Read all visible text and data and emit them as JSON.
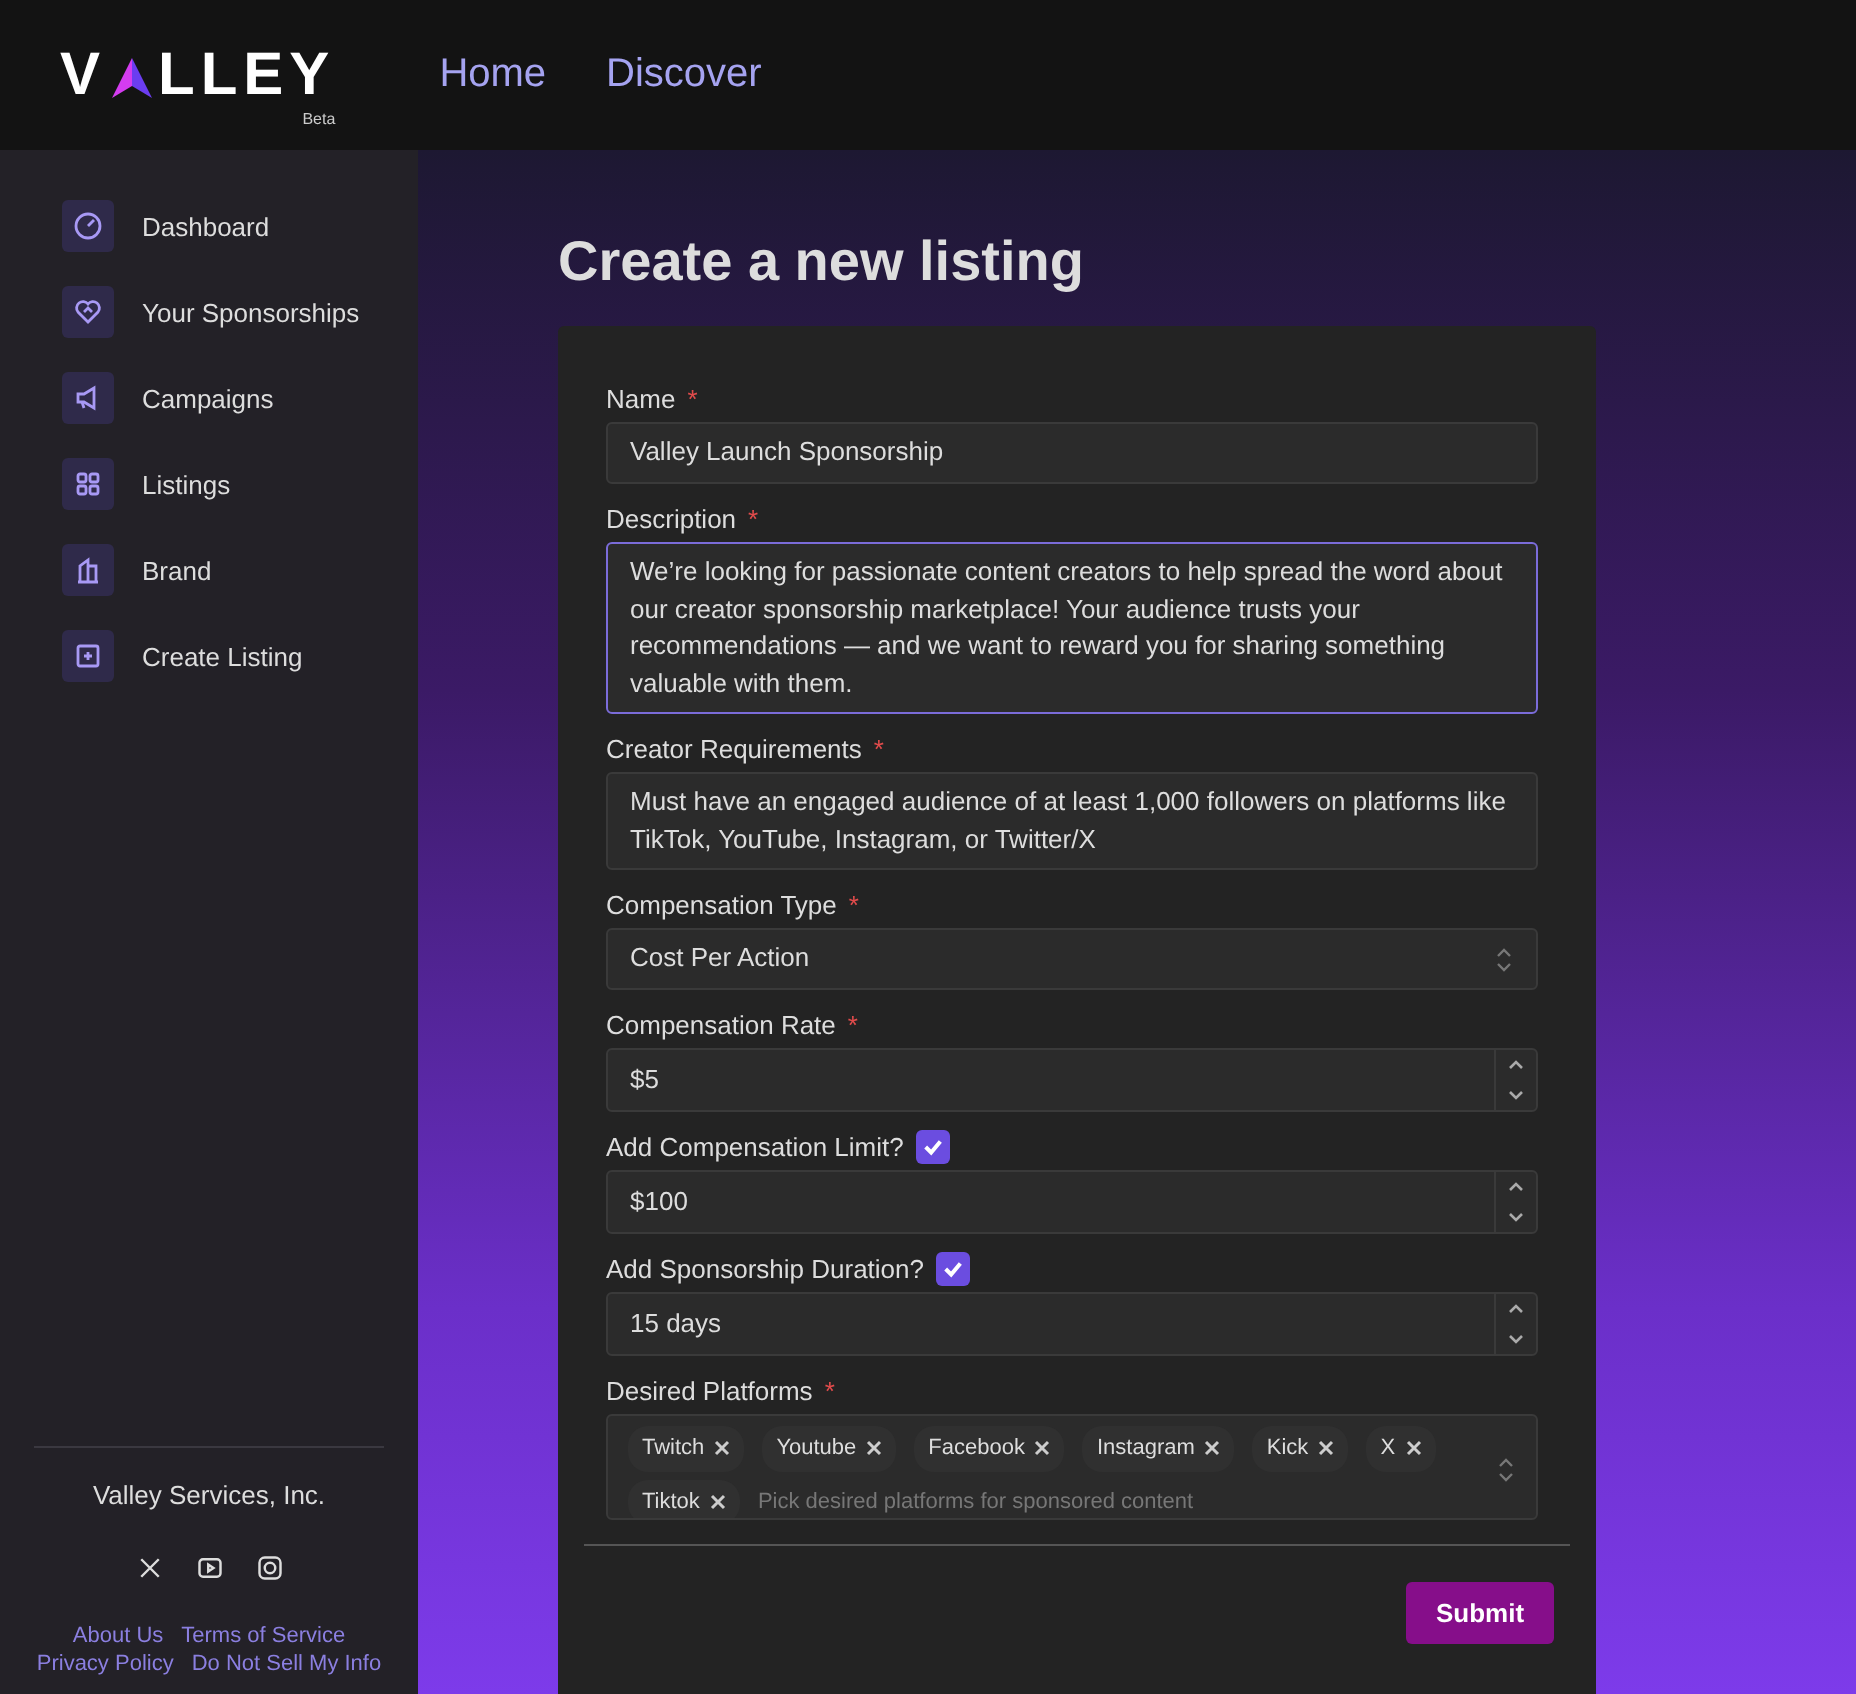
{
  "header": {
    "logo": {
      "start": "V",
      "end": "LLEY",
      "badge": "Beta"
    },
    "nav": [
      {
        "label": "Home"
      },
      {
        "label": "Discover"
      }
    ]
  },
  "sidebar": {
    "items": [
      {
        "label": "Dashboard"
      },
      {
        "label": "Your Sponsorships"
      },
      {
        "label": "Campaigns"
      },
      {
        "label": "Listings"
      },
      {
        "label": "Brand"
      },
      {
        "label": "Create Listing"
      }
    ],
    "company": "Valley Services, Inc.",
    "links": [
      [
        "About Us",
        "Terms of Service"
      ],
      [
        "Privacy Policy",
        "Do Not Sell My Info"
      ]
    ]
  },
  "page": {
    "title": "Create a new listing"
  },
  "form": {
    "fields": [
      {
        "kind": "text",
        "label": "Name",
        "required_mark": "*",
        "value": "Valley Launch Sponsorship"
      },
      {
        "kind": "textarea",
        "label": "Description",
        "required_mark": "*",
        "focused": true,
        "value": "We’re looking for passionate content creators to help spread the word about our creator sponsorship marketplace! Your audience trusts your recommendations — and we want to reward you for sharing something valuable with them."
      },
      {
        "kind": "textarea",
        "label": "Creator Requirements",
        "required_mark": "*",
        "focused": false,
        "value": "Must have an engaged audience of at least 1,000 followers on platforms like TikTok, YouTube, Instagram, or Twitter/X"
      },
      {
        "kind": "select",
        "label": "Compensation Type",
        "required_mark": "*",
        "value": "Cost Per Action"
      },
      {
        "kind": "number",
        "label": "Compensation Rate",
        "required_mark": "*",
        "value": "$5"
      },
      {
        "kind": "number",
        "label": "Add Compensation Limit?",
        "checked": true,
        "value": "$100"
      },
      {
        "kind": "number",
        "label": "Add Sponsorship Duration?",
        "checked": true,
        "value": "15 days"
      },
      {
        "kind": "tags",
        "label": "Desired Platforms",
        "required_mark": "*",
        "tags": [
          "Twitch",
          "Youtube",
          "Facebook",
          "Instagram",
          "Kick",
          "X",
          "Tiktok"
        ],
        "placeholder": "Pick desired platforms for sponsored content"
      }
    ],
    "submit": "Submit"
  }
}
